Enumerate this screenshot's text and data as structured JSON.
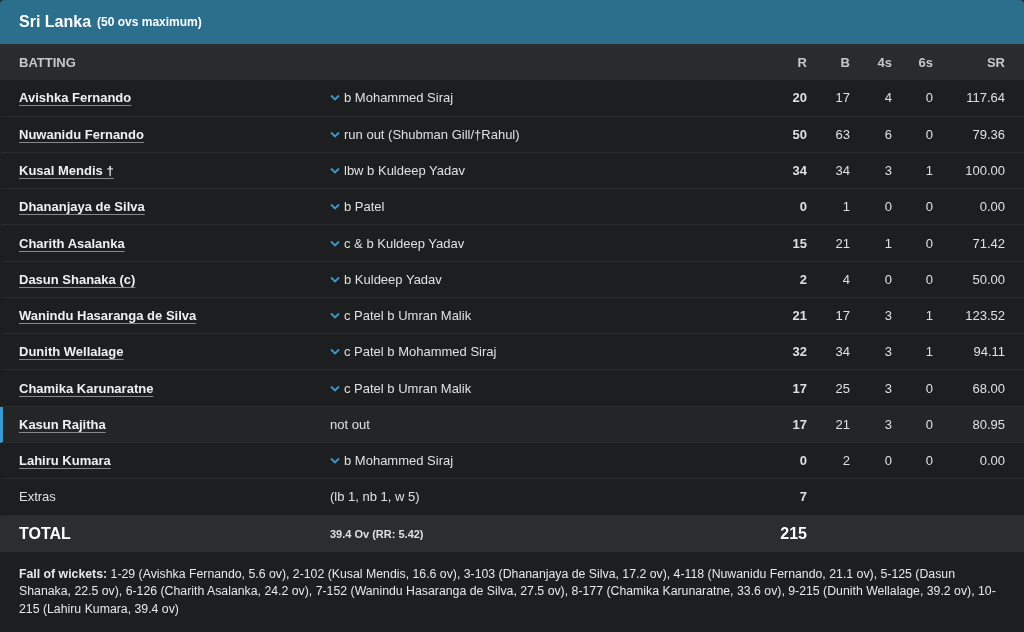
{
  "team": {
    "name": "Sri Lanka",
    "note": "(50 ovs maximum)"
  },
  "columns": [
    "BATTING",
    "R",
    "B",
    "4s",
    "6s",
    "SR"
  ],
  "rows": [
    {
      "batter": "Avishka Fernando",
      "expandable": true,
      "highlighted": false,
      "dismissal": "b Mohammed Siraj",
      "r": "20",
      "b": "17",
      "fours": "4",
      "sixes": "0",
      "sr": "117.64"
    },
    {
      "batter": "Nuwanidu Fernando",
      "expandable": true,
      "highlighted": false,
      "dismissal": "run out (Shubman Gill/†Rahul)",
      "r": "50",
      "b": "63",
      "fours": "6",
      "sixes": "0",
      "sr": "79.36"
    },
    {
      "batter": "Kusal Mendis †",
      "expandable": true,
      "highlighted": false,
      "dismissal": "lbw b Kuldeep Yadav",
      "r": "34",
      "b": "34",
      "fours": "3",
      "sixes": "1",
      "sr": "100.00"
    },
    {
      "batter": "Dhananjaya de Silva",
      "expandable": true,
      "highlighted": false,
      "dismissal": "b Patel",
      "r": "0",
      "b": "1",
      "fours": "0",
      "sixes": "0",
      "sr": "0.00"
    },
    {
      "batter": "Charith Asalanka",
      "expandable": true,
      "highlighted": false,
      "dismissal": "c & b Kuldeep Yadav",
      "r": "15",
      "b": "21",
      "fours": "1",
      "sixes": "0",
      "sr": "71.42"
    },
    {
      "batter": "Dasun Shanaka (c)",
      "expandable": true,
      "highlighted": false,
      "dismissal": "b Kuldeep Yadav",
      "r": "2",
      "b": "4",
      "fours": "0",
      "sixes": "0",
      "sr": "50.00"
    },
    {
      "batter": "Wanindu Hasaranga de Silva",
      "expandable": true,
      "highlighted": false,
      "dismissal": "c Patel b Umran Malik",
      "r": "21",
      "b": "17",
      "fours": "3",
      "sixes": "1",
      "sr": "123.52"
    },
    {
      "batter": "Dunith Wellalage",
      "expandable": true,
      "highlighted": false,
      "dismissal": "c Patel b Mohammed Siraj",
      "r": "32",
      "b": "34",
      "fours": "3",
      "sixes": "1",
      "sr": "94.11"
    },
    {
      "batter": "Chamika Karunaratne",
      "expandable": true,
      "highlighted": false,
      "dismissal": "c Patel b Umran Malik",
      "r": "17",
      "b": "25",
      "fours": "3",
      "sixes": "0",
      "sr": "68.00"
    },
    {
      "batter": "Kasun Rajitha",
      "expandable": false,
      "highlighted": true,
      "dismissal": "not out",
      "r": "17",
      "b": "21",
      "fours": "3",
      "sixes": "0",
      "sr": "80.95"
    },
    {
      "batter": "Lahiru Kumara",
      "expandable": true,
      "highlighted": false,
      "dismissal": "b Mohammed Siraj",
      "r": "0",
      "b": "2",
      "fours": "0",
      "sixes": "0",
      "sr": "0.00"
    }
  ],
  "extras": {
    "label": "Extras",
    "detail": "(lb 1, nb 1, w 5)",
    "runs": "7"
  },
  "total": {
    "label": "TOTAL",
    "detail": "39.4 Ov (RR: 5.42)",
    "runs": "215"
  },
  "fall_of_wickets": "**Fall of wickets:** 1-29 (Avishka Fernando, 5.6 ov), 2-102 (Kusal Mendis, 16.6 ov), 3-103 (Dhananjaya de Silva, 17.2 ov), 4-118 (Nuwanidu Fernando, 21.1 ov), 5-125 (Dasun Shanaka, 22.5 ov), 6-126 (Charith Asalanka, 24.2 ov), 7-152 (Wanindu Hasaranga de Silva, 27.5 ov), 8-177 (Chamika Karunaratne, 33.6 ov), 9-215 (Dunith Wellalage, 39.2 ov), 10-215 (Lahiru Kumara, 39.4 ov)"
}
